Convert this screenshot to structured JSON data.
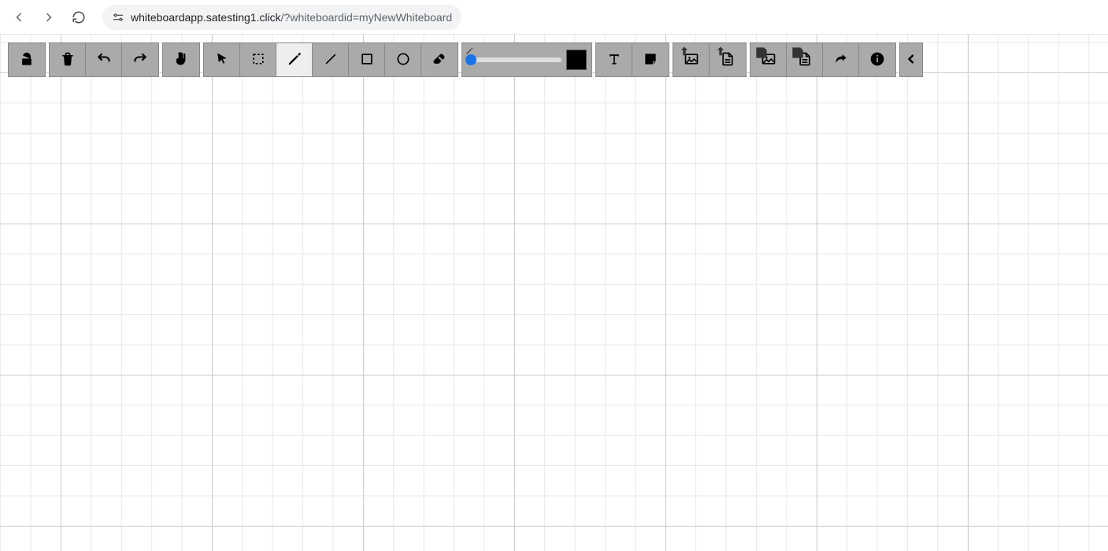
{
  "browser": {
    "url_host": "whiteboardapp.satesting1.click",
    "url_path": "/?whiteboardid=myNewWhiteboard",
    "back_enabled": false,
    "forward_enabled": false
  },
  "toolbar": {
    "lock": "unlock-icon",
    "trash": "trash-icon",
    "undo": "undo-icon",
    "redo": "redo-icon",
    "pan": "hand-icon",
    "select_pointer": "pointer-icon",
    "select_rect": "marquee-icon",
    "draw_pen": "pencil-icon",
    "draw_line": "line-icon",
    "draw_rect": "square-icon",
    "draw_circle": "circle-icon",
    "eraser": "eraser-icon",
    "active_tool": "draw_pen",
    "thickness": {
      "min": 1,
      "max": 50,
      "value": 3
    },
    "color": "#000000",
    "text": "text-icon",
    "sticky": "sticky-note-icon",
    "upload_image": "upload-image-icon",
    "upload_file": "upload-file-icon",
    "save_image": "save-image-icon",
    "save_file": "save-file-icon",
    "share": "share-icon",
    "info": "info-icon",
    "collapse": "chevron-left-icon"
  }
}
